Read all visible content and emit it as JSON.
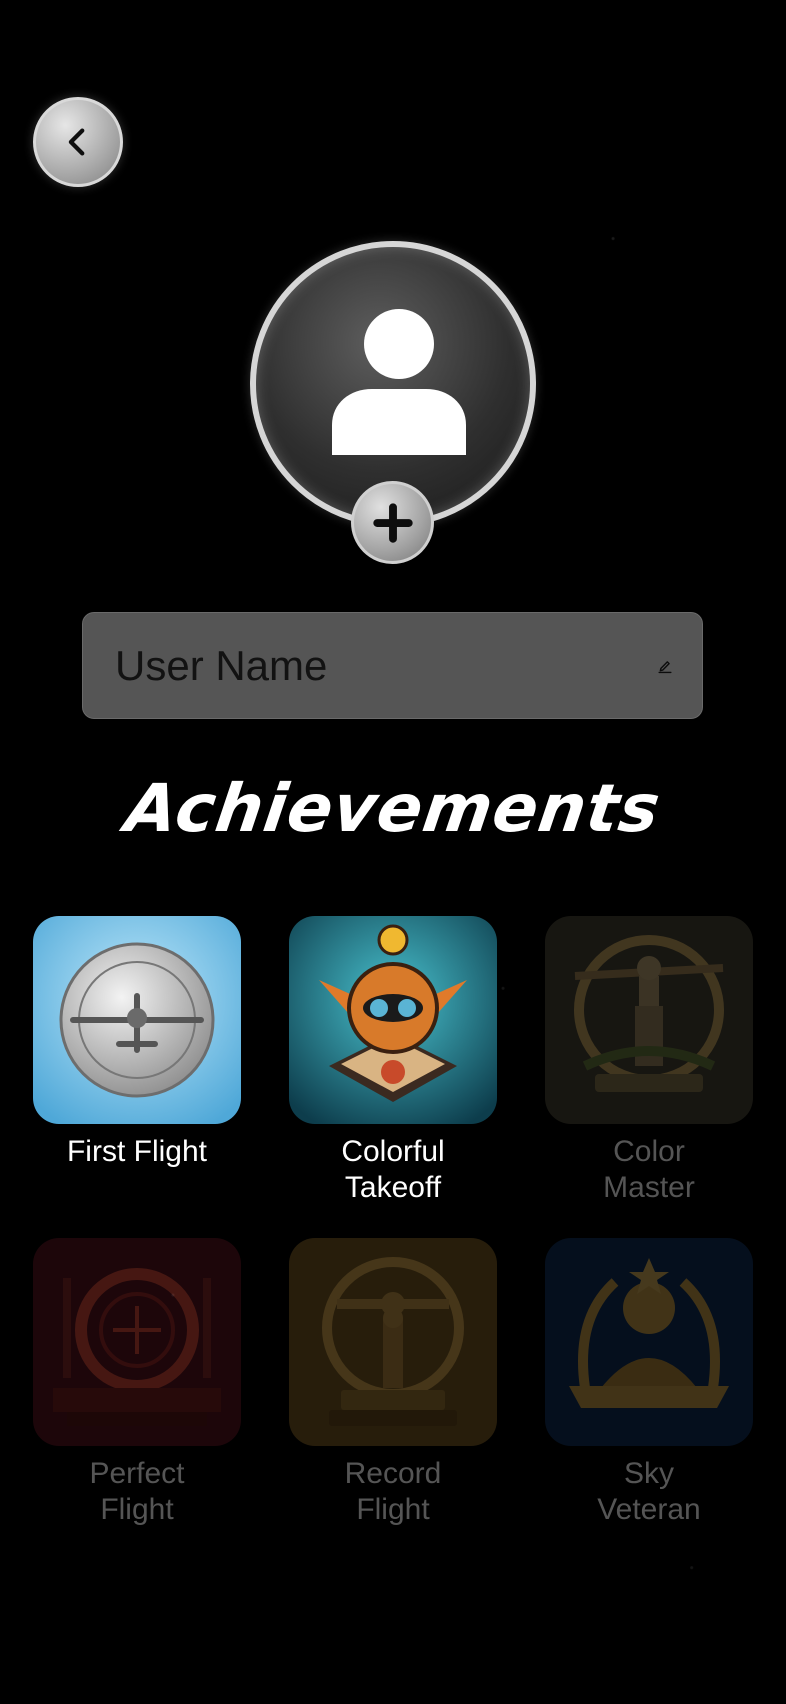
{
  "username": {
    "placeholder": "User Name"
  },
  "achievements": {
    "title": "Achievements",
    "items": [
      {
        "label": "First Flight",
        "locked": false,
        "icon": "silver-plane-medal-icon",
        "color": "#7ec8e8"
      },
      {
        "label": "Colorful Takeoff",
        "locked": false,
        "icon": "pilot-helmet-badge-icon",
        "color": "#1d7a8c"
      },
      {
        "label": "Color Master",
        "locked": true,
        "icon": "pilot-trophy-icon",
        "color": "#8a7a58"
      },
      {
        "label": "Perfect Flight",
        "locked": true,
        "icon": "ring-target-icon",
        "color": "#8a2a2a"
      },
      {
        "label": "Record Flight",
        "locked": true,
        "icon": "record-plane-trophy-icon",
        "color": "#9a7a3a"
      },
      {
        "label": "Sky Veteran",
        "locked": true,
        "icon": "veteran-pilot-emblem-icon",
        "color": "#2a4a7a"
      }
    ]
  }
}
